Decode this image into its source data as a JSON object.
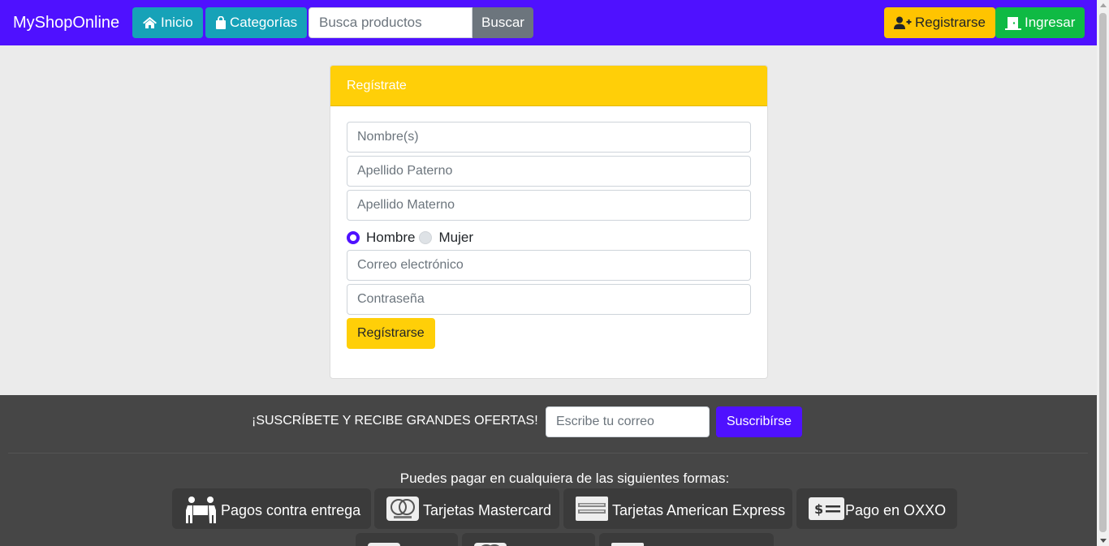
{
  "navbar": {
    "brand": "MyShopOnline",
    "home_label": "Inicio",
    "categories_label": "Categorías",
    "search_placeholder": "Busca productos",
    "search_button": "Buscar",
    "register_label": "Registrarse",
    "login_label": "Ingresar"
  },
  "form": {
    "header": "Regístrate",
    "first_name_placeholder": "Nombre(s)",
    "paternal_placeholder": "Apellido Paterno",
    "maternal_placeholder": "Apellido Materno",
    "gender_options": [
      "Hombre",
      "Mujer"
    ],
    "gender_selected": "Hombre",
    "email_placeholder": "Correo electrónico",
    "password_placeholder": "Contraseña",
    "submit_label": "Regístrarse"
  },
  "footer": {
    "subscribe_text": "¡SUSCRÍBETE Y RECIBE GRANDES OFERTAS!",
    "subscribe_placeholder": "Escribe tu correo",
    "subscribe_button": "Suscribírse",
    "payment_title": "Puedes pagar en cualquiera de las siguientes formas:",
    "payment_methods": [
      {
        "label": "Pagos contra entrega",
        "icon": "delivery-people-icon"
      },
      {
        "label": "Tarjetas Mastercard",
        "icon": "mastercard-icon"
      },
      {
        "label": "Tarjetas American Express",
        "icon": "amex-icon"
      },
      {
        "label": "Pago en OXXO",
        "icon": "cash-bill-icon"
      }
    ]
  },
  "colors": {
    "primary": "#4f11ff",
    "info": "#16a2b8",
    "warning": "#ffc400",
    "success": "#0fba44",
    "footer_bg": "#464646"
  }
}
